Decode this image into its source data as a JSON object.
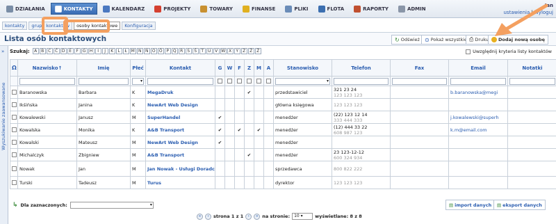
{
  "menu": [
    {
      "label": "DZIAŁANIA",
      "icon": "wrench-icon",
      "color": "#7a8da6"
    },
    {
      "label": "KONTAKTY",
      "icon": "contacts-icon",
      "color": "#ffffff",
      "active": true
    },
    {
      "label": "KALENDARZ",
      "icon": "calendar-icon",
      "color": "#4a78c0"
    },
    {
      "label": "PROJEKTY",
      "icon": "projects-icon",
      "color": "#d44030"
    },
    {
      "label": "TOWARY",
      "icon": "goods-icon",
      "color": "#c89030"
    },
    {
      "label": "FINANSE",
      "icon": "finance-icon",
      "color": "#e0b020"
    },
    {
      "label": "PLIKI",
      "icon": "files-icon",
      "color": "#6a8cb8"
    },
    {
      "label": "FLOTA",
      "icon": "fleet-icon",
      "color": "#3c6fb0"
    },
    {
      "label": "RAPORTY",
      "icon": "reports-icon",
      "color": "#c05030"
    },
    {
      "label": "ADMIN",
      "icon": "admin-icon",
      "color": "#8a96a8"
    }
  ],
  "user": {
    "name": "Jan",
    "settings": "ustawienia",
    "logout": "wyloguj"
  },
  "subtabs": [
    "kontakty",
    "grupy kontaktów",
    "osoby kontaktowe",
    "Konfiguracja"
  ],
  "page": {
    "title": "Lista osób kontaktowych"
  },
  "actions": {
    "refresh": "Odśwież",
    "show_all": "Pokaż wszystkie",
    "print": "Drukuj",
    "add": "Dodaj nową osobę"
  },
  "search": {
    "label": "Szukaj:",
    "letters": [
      "A",
      "B",
      "C",
      "Ć",
      "D",
      "E",
      "F",
      "G",
      "H",
      "I",
      "J",
      "K",
      "L",
      "Ł",
      "M",
      "N",
      "Ń",
      "O",
      "Ó",
      "P",
      "Q",
      "R",
      "S",
      "Ś",
      "T",
      "U",
      "V",
      "W",
      "X",
      "Y",
      "Z",
      "Ź",
      "Ż"
    ],
    "criteria_label": "Uwzględnij kryteria listy kontaktów"
  },
  "sidebar": {
    "label": "Wyszukiwanie zaawansowane"
  },
  "table": {
    "headers": {
      "surname": "Nazwisko↑",
      "name": "Imię",
      "gender": "Płeć",
      "contact": "Kontakt",
      "g": "G",
      "w": "W",
      "f": "F",
      "z": "Z",
      "m": "M",
      "a": "A",
      "position": "Stanowisko",
      "phone": "Telefon",
      "fax": "Fax",
      "email": "Email",
      "notes": "Notatki"
    },
    "rows": [
      {
        "surname": "Baranowska",
        "name": "Barbara",
        "gender": "K",
        "contact": "MegaDruk",
        "g": "",
        "w": "",
        "f": "",
        "z": "✔",
        "m": "",
        "a": "",
        "position": "przedstawiciel",
        "phone1": "321 23 24",
        "phone2": "123 123 123",
        "fax": "",
        "email": "b.baranowska@megi",
        "notes": ""
      },
      {
        "surname": "Ikśińska",
        "name": "Janina",
        "gender": "K",
        "contact": "NewArt Web Design",
        "g": "",
        "w": "",
        "f": "",
        "z": "",
        "m": "",
        "a": "",
        "position": "główna księgowa",
        "phone1": "",
        "phone2": "123 123 123",
        "fax": "",
        "email": "",
        "notes": ""
      },
      {
        "surname": "Kowalewski",
        "name": "Janusz",
        "gender": "M",
        "contact": "SuperHandel",
        "g": "✔",
        "w": "",
        "f": "",
        "z": "",
        "m": "",
        "a": "",
        "position": "menedżer",
        "phone1": "(22) 123 12 14",
        "phone2": "333 444 333",
        "fax": "",
        "email": "j.kowalewski@superh",
        "notes": ""
      },
      {
        "surname": "Kowalska",
        "name": "Monika",
        "gender": "K",
        "contact": "A&B Transport",
        "g": "✔",
        "w": "",
        "f": "✔",
        "z": "",
        "m": "✔",
        "a": "",
        "position": "menedżer",
        "phone1": "(12) 444 33 22",
        "phone2": "608 987 123",
        "fax": "",
        "email": "k.m@email.com",
        "notes": ""
      },
      {
        "surname": "Kowalski",
        "name": "Mateusz",
        "gender": "M",
        "contact": "NewArt Web Design",
        "g": "✔",
        "w": "",
        "f": "",
        "z": "",
        "m": "",
        "a": "",
        "position": "menedżer",
        "phone1": "",
        "phone2": "",
        "fax": "",
        "email": "",
        "notes": ""
      },
      {
        "surname": "Michalczyk",
        "name": "Zbigniew",
        "gender": "M",
        "contact": "A&B Transport",
        "g": "",
        "w": "",
        "f": "",
        "z": "✔",
        "m": "",
        "a": "",
        "position": "menedżer",
        "phone1": "23 123-12-12",
        "phone2": "600 324 934",
        "fax": "",
        "email": "",
        "notes": ""
      },
      {
        "surname": "Nowak",
        "name": "Jan",
        "gender": "M",
        "contact": "Jan Nowak - Usługi Doradcze",
        "g": "",
        "w": "",
        "f": "",
        "z": "",
        "m": "",
        "a": "",
        "position": "sprzedawca",
        "phone1": "",
        "phone2": "800 822 222",
        "fax": "",
        "email": "",
        "notes": ""
      },
      {
        "surname": "Turski",
        "name": "Tadeusz",
        "gender": "M",
        "contact": "Turus",
        "g": "",
        "w": "",
        "f": "",
        "z": "",
        "m": "",
        "a": "",
        "position": "dyrektor",
        "phone1": "",
        "phone2": "123 123 123",
        "fax": "",
        "email": "",
        "notes": ""
      }
    ]
  },
  "bottom": {
    "selected_label": "Dla zaznaczonych:",
    "import": "import danych",
    "export": "eksport danych"
  },
  "pager": {
    "page_text": "strona 1 z 1",
    "per_page_label": "na stronie:",
    "per_page": "10",
    "shown": "wyświetlane: 8 z 8"
  },
  "colors": {
    "accent": "#2a5db0",
    "highlight": "#f4a060"
  }
}
